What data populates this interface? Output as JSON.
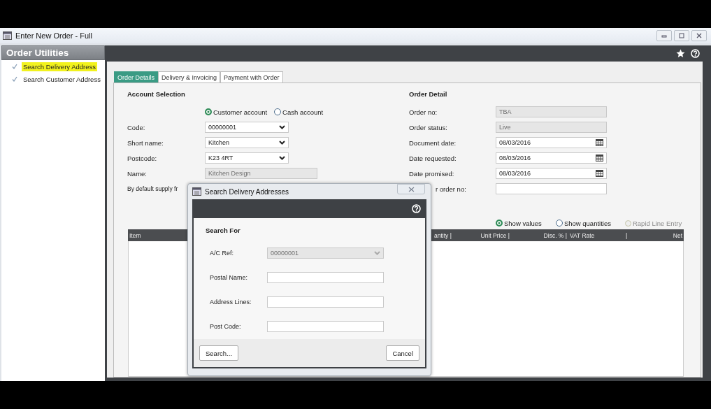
{
  "window": {
    "title": "Enter New Order - Full"
  },
  "sidebar": {
    "title": "Order Utilities",
    "items": [
      {
        "label": "Search Delivery Address",
        "highlighted": true
      },
      {
        "label": "Search Customer Address",
        "highlighted": false
      }
    ]
  },
  "tabs": [
    {
      "label": "Order Details",
      "selected": true
    },
    {
      "label": "Delivery & Invoicing",
      "selected": false
    },
    {
      "label": "Payment with Order",
      "selected": false
    }
  ],
  "account_selection": {
    "heading": "Account Selection",
    "account_types": [
      {
        "label": "Customer account",
        "selected": true
      },
      {
        "label": "Cash account",
        "selected": false
      }
    ],
    "fields": [
      {
        "label": "Code:",
        "value": "00000001",
        "kind": "dropdown",
        "disabled": false
      },
      {
        "label": "Short name:",
        "value": "Kitchen",
        "kind": "dropdown",
        "disabled": false
      },
      {
        "label": "Postcode:",
        "value": "K23 4RT",
        "kind": "dropdown",
        "disabled": false
      },
      {
        "label": "Name:",
        "value": "Kitchen Design",
        "kind": "text",
        "disabled": true
      }
    ],
    "supply_label": "By default supply fr"
  },
  "order_detail": {
    "heading": "Order Detail",
    "fields": [
      {
        "label": "Order no:",
        "value": "TBA",
        "kind": "text",
        "disabled": true
      },
      {
        "label": "Order status:",
        "value": "Live",
        "kind": "text",
        "disabled": true
      },
      {
        "label": "Document date:",
        "value": "08/03/2016",
        "kind": "date",
        "disabled": false
      },
      {
        "label": "Date requested:",
        "value": "08/03/2016",
        "kind": "date",
        "disabled": false
      },
      {
        "label": "Date promised:",
        "value": "08/03/2016",
        "kind": "date",
        "disabled": false
      },
      {
        "label": "r order no:",
        "kind": "text",
        "disabled": false
      }
    ]
  },
  "display_options": [
    {
      "label": "Show values",
      "selected": true
    },
    {
      "label": "Show quantities",
      "selected": false
    }
  ],
  "rapid_line_entry": {
    "label": "Rapid Line Entry",
    "disabled": true
  },
  "table": {
    "columns": [
      "Item",
      "antity |",
      "Unit Price |",
      "Disc. % |",
      "VAT Rate",
      "|",
      "Net"
    ]
  },
  "dialog": {
    "title": "Search Delivery Addresses",
    "heading": "Search For",
    "fields": [
      {
        "label": "A/C Ref:",
        "value": "00000001",
        "kind": "dropdown",
        "disabled": true
      },
      {
        "label": "Postal Name:",
        "kind": "text",
        "disabled": false
      },
      {
        "label": "Address Lines:",
        "kind": "text",
        "disabled": false
      },
      {
        "label": "Post Code:",
        "kind": "text",
        "disabled": false
      }
    ],
    "buttons": [
      "Search...",
      "Cancel"
    ]
  }
}
